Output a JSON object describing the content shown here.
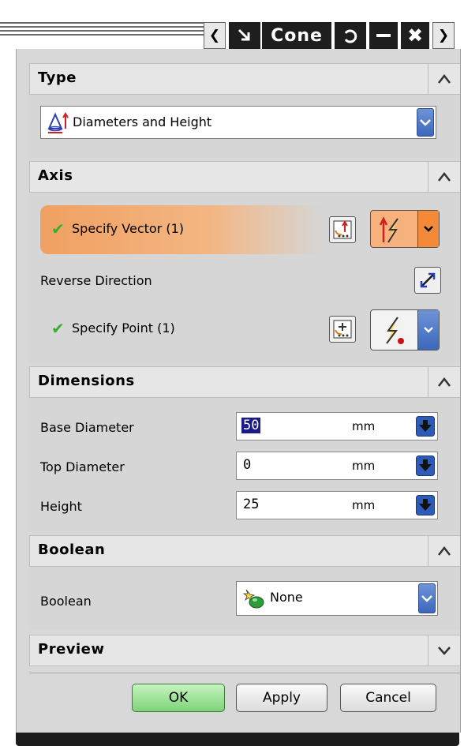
{
  "titlebar": {
    "title": "Cone"
  },
  "type_section": {
    "header": "Type",
    "selected": "Diameters and Height"
  },
  "axis_section": {
    "header": "Axis",
    "specify_vector": "Specify Vector (1)",
    "reverse_direction": "Reverse Direction",
    "specify_point": "Specify Point (1)"
  },
  "dimensions_section": {
    "header": "Dimensions",
    "rows": [
      {
        "label": "Base Diameter",
        "value": "50",
        "unit": "mm"
      },
      {
        "label": "Top Diameter",
        "value": "0",
        "unit": "mm"
      },
      {
        "label": "Height",
        "value": "25",
        "unit": "mm"
      }
    ]
  },
  "boolean_section": {
    "header": "Boolean",
    "label": "Boolean",
    "selected": "None"
  },
  "preview_section": {
    "header": "Preview"
  },
  "buttons": {
    "ok": "OK",
    "apply": "Apply",
    "cancel": "Cancel"
  },
  "colors": {
    "accent_orange": "#f0a062",
    "check_green": "#33b030",
    "ok_green": "#8fdc86"
  }
}
